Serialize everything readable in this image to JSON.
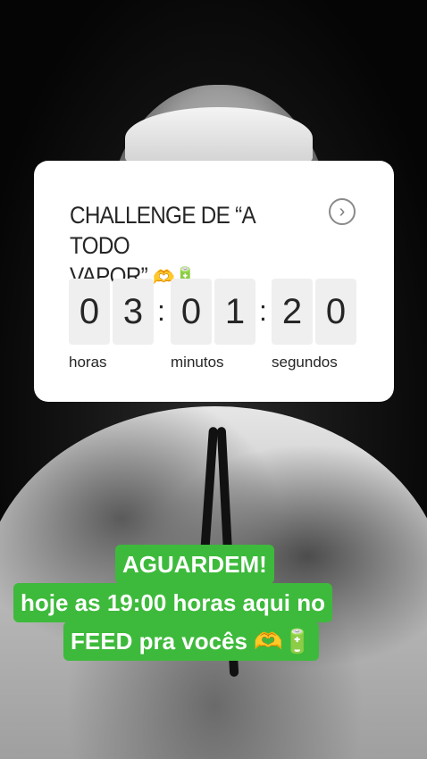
{
  "sticker": {
    "title_line1": "CHALLENGE DE “A TODO",
    "title_line2": "VAPOR”",
    "title_emoji": "🫶🔋",
    "arrow_icon": "chevron-right-circle-icon",
    "digits": [
      "0",
      "3",
      "0",
      "1",
      "2",
      "0"
    ],
    "separators": [
      ":",
      ":"
    ],
    "units": [
      "horas",
      "minutos",
      "segundos"
    ]
  },
  "caption": {
    "line1": "AGUARDEM!",
    "line2": "hoje as 19:00 horas aqui no",
    "line3": "FEED pra vocês",
    "line3_emoji": "🫶🔋",
    "color": "#3dba3b"
  }
}
